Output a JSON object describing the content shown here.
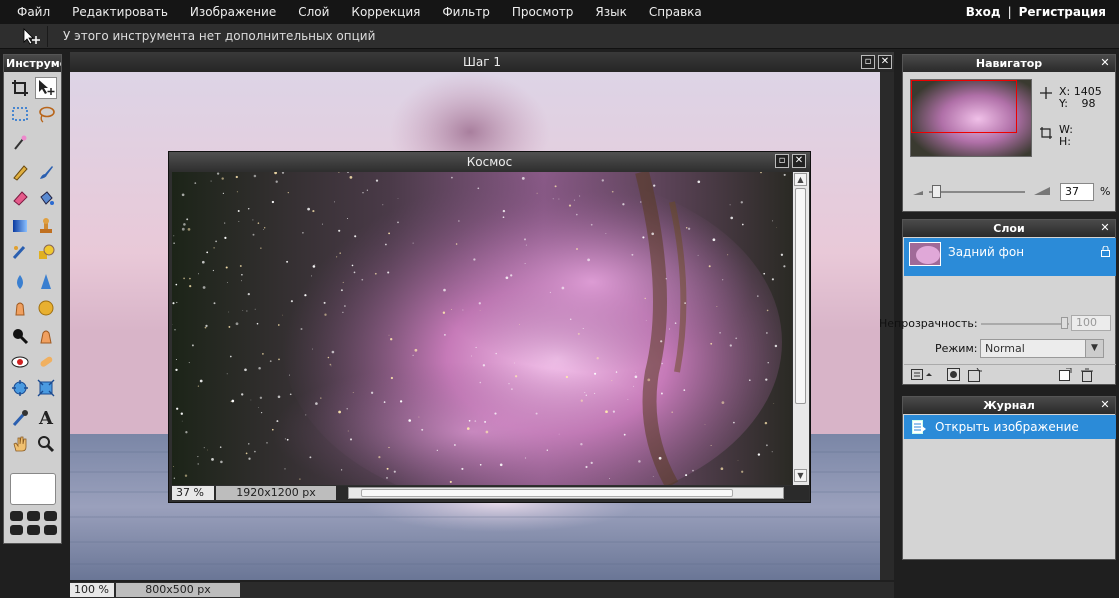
{
  "menu": {
    "items": [
      "Файл",
      "Редактировать",
      "Изображение",
      "Слой",
      "Коррекция",
      "Фильтр",
      "Просмотр",
      "Язык",
      "Справка"
    ],
    "login": "Вход",
    "separator": "|",
    "register": "Регистрация"
  },
  "options_bar": {
    "tool_icon": "move-tool-icon",
    "text": "У этого инструмента нет дополнительных опций"
  },
  "tools_panel": {
    "title": "Инструменты",
    "tools": [
      "crop",
      "move",
      "marquee",
      "lasso",
      "magic-wand",
      "pencil",
      "brush",
      "eraser",
      "bucket",
      "gradient",
      "stamp",
      "color-replace",
      "shapes",
      "blur",
      "sharpen",
      "smudge",
      "sponge",
      "dodge",
      "burn",
      "red-eye",
      "spot-heal",
      "bloat",
      "pinch",
      "color-picker",
      "type",
      "hand",
      "zoom"
    ],
    "selected": "move"
  },
  "document": {
    "title": "Шаг 1",
    "zoom": "100",
    "zoom_unit": "%",
    "size": "800x500 px"
  },
  "inner_window": {
    "title": "Космос",
    "zoom": "37",
    "zoom_unit": "%",
    "size": "1920x1200 px"
  },
  "navigator": {
    "title": "Навигатор",
    "x_label": "X:",
    "x_value": "1405",
    "y_label": "Y:",
    "y_value": "98",
    "w_label": "W:",
    "h_label": "H:",
    "zoom": "37",
    "zoom_unit": "%"
  },
  "layers": {
    "title": "Слои",
    "items": [
      {
        "name": "Задний фон",
        "locked": true
      }
    ],
    "opacity_label": "Непрозрачность:",
    "opacity_value": "100",
    "mode_label": "Режим:",
    "mode_value": "Normal"
  },
  "history": {
    "title": "Журнал",
    "items": [
      "Открыть изображение"
    ]
  },
  "colors": {
    "accent": "#2b8bd8",
    "background": "#1f1f1f",
    "panel": "#d4d4d4"
  }
}
